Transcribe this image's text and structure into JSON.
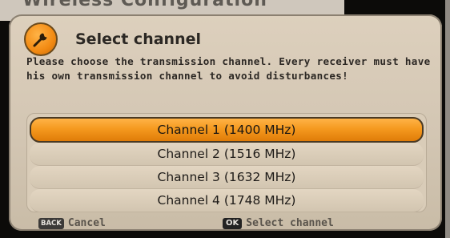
{
  "background": {
    "title": "Wireless Configuration"
  },
  "dialog": {
    "icon": "wrench-icon",
    "title": "Select channel",
    "description": "Please choose the transmission channel. Every receiver must have his own transmission channel to avoid disturbances!",
    "channels": [
      {
        "label": "Channel 1 (1400 MHz)",
        "selected": true
      },
      {
        "label": "Channel 2 (1516 MHz)",
        "selected": false
      },
      {
        "label": "Channel 3 (1632 MHz)",
        "selected": false
      },
      {
        "label": "Channel 4 (1748 MHz)",
        "selected": false
      }
    ],
    "footer": {
      "cancel_key": "BACK",
      "cancel_label": "Cancel",
      "ok_key": "OK",
      "ok_label": "Select channel"
    }
  },
  "colors": {
    "accent": "#f59a1f",
    "dialog_bg": "#d8cbb8",
    "text": "#2c2824"
  }
}
